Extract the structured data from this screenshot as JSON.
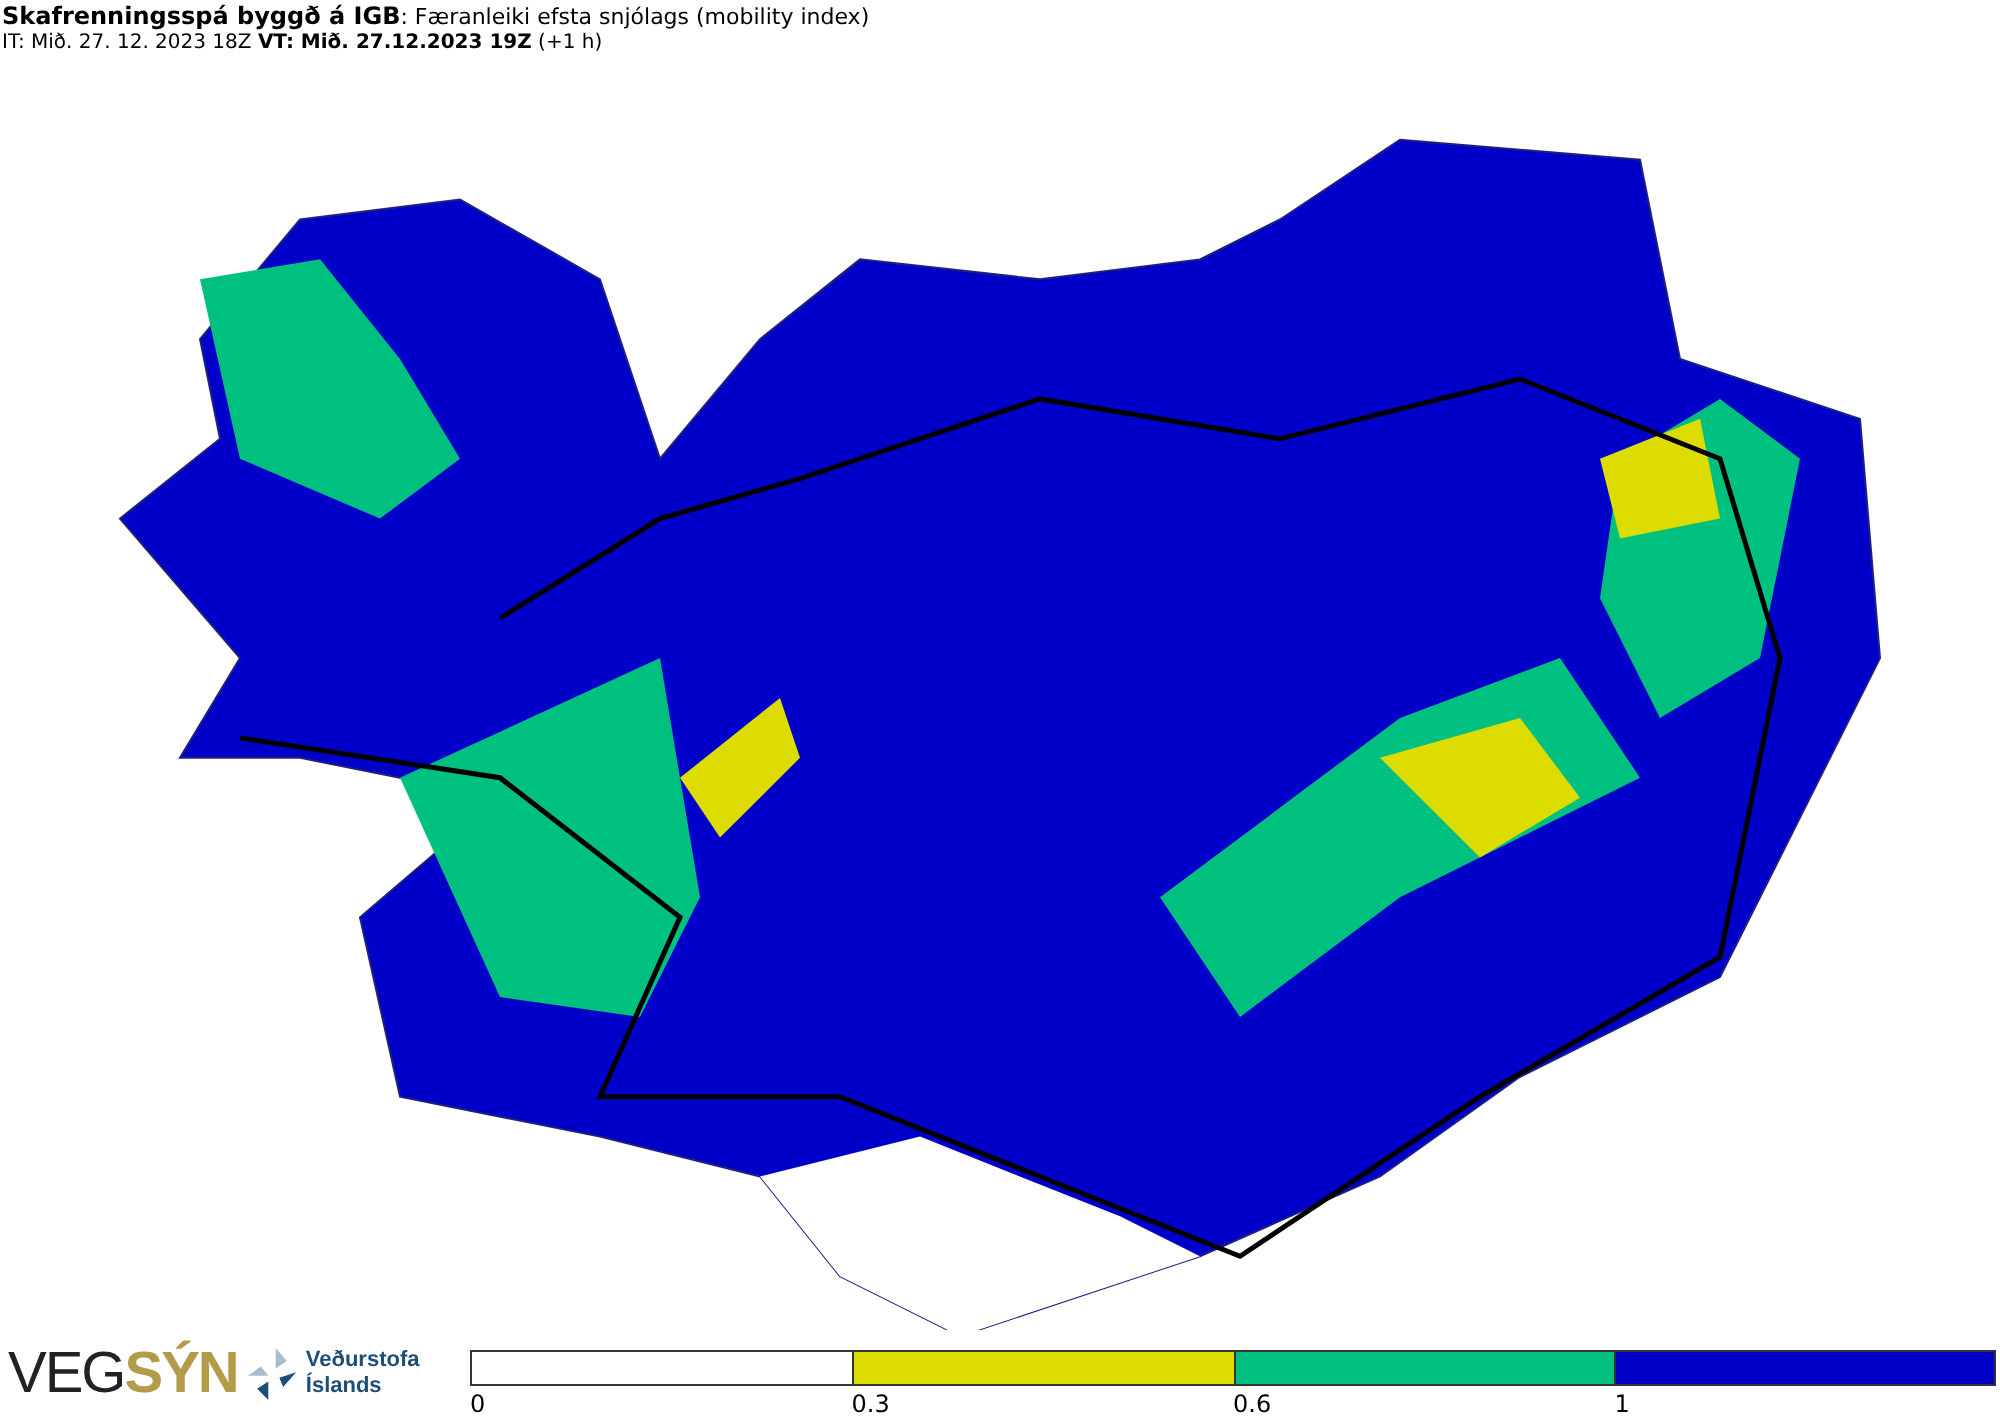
{
  "header": {
    "title": "**Skafrenningsspá byggð á IGB**: Færanleiki efsta snjólags (mobility index)",
    "subtitle": "IT: Mið. 27. 12. 2023 18Z **VT: Mið. 27.12.2023 19Z** (+1 h)"
  },
  "logos": {
    "vegsyn": [
      "VEG",
      "SÝN"
    ],
    "vedurstofa": [
      "Veðurstofa",
      "Íslands"
    ]
  },
  "legend": [
    {
      "label": "0",
      "color": "#ffffff"
    },
    {
      "label": "0.3",
      "color": "#dcdc00"
    },
    {
      "label": "0.6",
      "color": "#00c080"
    },
    {
      "label": "1",
      "color": "#0000c8"
    }
  ]
}
